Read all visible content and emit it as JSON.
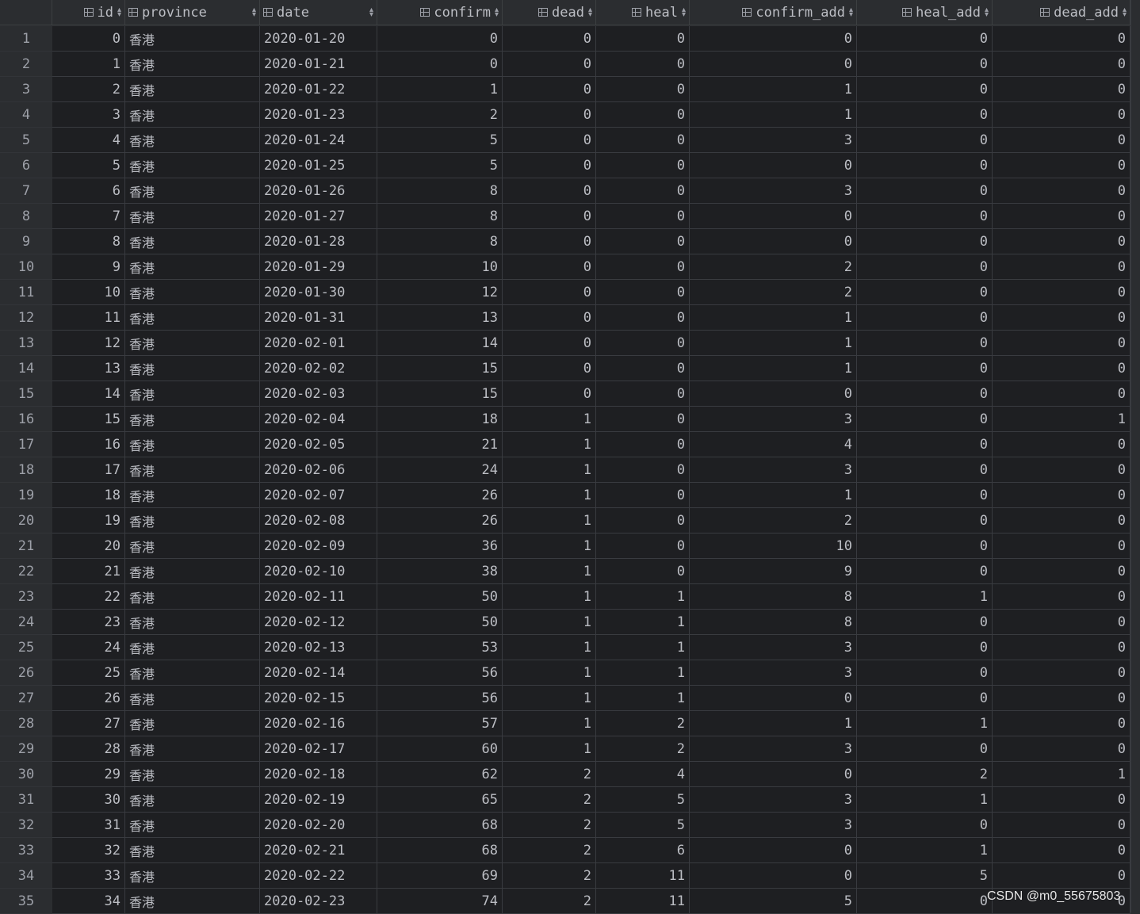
{
  "columns": [
    {
      "key": "id",
      "label": "id",
      "align": "right"
    },
    {
      "key": "province",
      "label": "province",
      "align": "left"
    },
    {
      "key": "date",
      "label": "date",
      "align": "left"
    },
    {
      "key": "confirm",
      "label": "confirm",
      "align": "right"
    },
    {
      "key": "dead",
      "label": "dead",
      "align": "right"
    },
    {
      "key": "heal",
      "label": "heal",
      "align": "right"
    },
    {
      "key": "confirm_add",
      "label": "confirm_add",
      "align": "right"
    },
    {
      "key": "heal_add",
      "label": "heal_add",
      "align": "right"
    },
    {
      "key": "dead_add",
      "label": "dead_add",
      "align": "right"
    }
  ],
  "rows": [
    {
      "n": "1",
      "id": "0",
      "province": "香港",
      "date": "2020-01-20",
      "confirm": "0",
      "dead": "0",
      "heal": "0",
      "confirm_add": "0",
      "heal_add": "0",
      "dead_add": "0"
    },
    {
      "n": "2",
      "id": "1",
      "province": "香港",
      "date": "2020-01-21",
      "confirm": "0",
      "dead": "0",
      "heal": "0",
      "confirm_add": "0",
      "heal_add": "0",
      "dead_add": "0"
    },
    {
      "n": "3",
      "id": "2",
      "province": "香港",
      "date": "2020-01-22",
      "confirm": "1",
      "dead": "0",
      "heal": "0",
      "confirm_add": "1",
      "heal_add": "0",
      "dead_add": "0"
    },
    {
      "n": "4",
      "id": "3",
      "province": "香港",
      "date": "2020-01-23",
      "confirm": "2",
      "dead": "0",
      "heal": "0",
      "confirm_add": "1",
      "heal_add": "0",
      "dead_add": "0"
    },
    {
      "n": "5",
      "id": "4",
      "province": "香港",
      "date": "2020-01-24",
      "confirm": "5",
      "dead": "0",
      "heal": "0",
      "confirm_add": "3",
      "heal_add": "0",
      "dead_add": "0"
    },
    {
      "n": "6",
      "id": "5",
      "province": "香港",
      "date": "2020-01-25",
      "confirm": "5",
      "dead": "0",
      "heal": "0",
      "confirm_add": "0",
      "heal_add": "0",
      "dead_add": "0"
    },
    {
      "n": "7",
      "id": "6",
      "province": "香港",
      "date": "2020-01-26",
      "confirm": "8",
      "dead": "0",
      "heal": "0",
      "confirm_add": "3",
      "heal_add": "0",
      "dead_add": "0"
    },
    {
      "n": "8",
      "id": "7",
      "province": "香港",
      "date": "2020-01-27",
      "confirm": "8",
      "dead": "0",
      "heal": "0",
      "confirm_add": "0",
      "heal_add": "0",
      "dead_add": "0"
    },
    {
      "n": "9",
      "id": "8",
      "province": "香港",
      "date": "2020-01-28",
      "confirm": "8",
      "dead": "0",
      "heal": "0",
      "confirm_add": "0",
      "heal_add": "0",
      "dead_add": "0"
    },
    {
      "n": "10",
      "id": "9",
      "province": "香港",
      "date": "2020-01-29",
      "confirm": "10",
      "dead": "0",
      "heal": "0",
      "confirm_add": "2",
      "heal_add": "0",
      "dead_add": "0"
    },
    {
      "n": "11",
      "id": "10",
      "province": "香港",
      "date": "2020-01-30",
      "confirm": "12",
      "dead": "0",
      "heal": "0",
      "confirm_add": "2",
      "heal_add": "0",
      "dead_add": "0"
    },
    {
      "n": "12",
      "id": "11",
      "province": "香港",
      "date": "2020-01-31",
      "confirm": "13",
      "dead": "0",
      "heal": "0",
      "confirm_add": "1",
      "heal_add": "0",
      "dead_add": "0"
    },
    {
      "n": "13",
      "id": "12",
      "province": "香港",
      "date": "2020-02-01",
      "confirm": "14",
      "dead": "0",
      "heal": "0",
      "confirm_add": "1",
      "heal_add": "0",
      "dead_add": "0"
    },
    {
      "n": "14",
      "id": "13",
      "province": "香港",
      "date": "2020-02-02",
      "confirm": "15",
      "dead": "0",
      "heal": "0",
      "confirm_add": "1",
      "heal_add": "0",
      "dead_add": "0"
    },
    {
      "n": "15",
      "id": "14",
      "province": "香港",
      "date": "2020-02-03",
      "confirm": "15",
      "dead": "0",
      "heal": "0",
      "confirm_add": "0",
      "heal_add": "0",
      "dead_add": "0"
    },
    {
      "n": "16",
      "id": "15",
      "province": "香港",
      "date": "2020-02-04",
      "confirm": "18",
      "dead": "1",
      "heal": "0",
      "confirm_add": "3",
      "heal_add": "0",
      "dead_add": "1"
    },
    {
      "n": "17",
      "id": "16",
      "province": "香港",
      "date": "2020-02-05",
      "confirm": "21",
      "dead": "1",
      "heal": "0",
      "confirm_add": "4",
      "heal_add": "0",
      "dead_add": "0"
    },
    {
      "n": "18",
      "id": "17",
      "province": "香港",
      "date": "2020-02-06",
      "confirm": "24",
      "dead": "1",
      "heal": "0",
      "confirm_add": "3",
      "heal_add": "0",
      "dead_add": "0"
    },
    {
      "n": "19",
      "id": "18",
      "province": "香港",
      "date": "2020-02-07",
      "confirm": "26",
      "dead": "1",
      "heal": "0",
      "confirm_add": "1",
      "heal_add": "0",
      "dead_add": "0"
    },
    {
      "n": "20",
      "id": "19",
      "province": "香港",
      "date": "2020-02-08",
      "confirm": "26",
      "dead": "1",
      "heal": "0",
      "confirm_add": "2",
      "heal_add": "0",
      "dead_add": "0"
    },
    {
      "n": "21",
      "id": "20",
      "province": "香港",
      "date": "2020-02-09",
      "confirm": "36",
      "dead": "1",
      "heal": "0",
      "confirm_add": "10",
      "heal_add": "0",
      "dead_add": "0"
    },
    {
      "n": "22",
      "id": "21",
      "province": "香港",
      "date": "2020-02-10",
      "confirm": "38",
      "dead": "1",
      "heal": "0",
      "confirm_add": "9",
      "heal_add": "0",
      "dead_add": "0"
    },
    {
      "n": "23",
      "id": "22",
      "province": "香港",
      "date": "2020-02-11",
      "confirm": "50",
      "dead": "1",
      "heal": "1",
      "confirm_add": "8",
      "heal_add": "1",
      "dead_add": "0"
    },
    {
      "n": "24",
      "id": "23",
      "province": "香港",
      "date": "2020-02-12",
      "confirm": "50",
      "dead": "1",
      "heal": "1",
      "confirm_add": "8",
      "heal_add": "0",
      "dead_add": "0"
    },
    {
      "n": "25",
      "id": "24",
      "province": "香港",
      "date": "2020-02-13",
      "confirm": "53",
      "dead": "1",
      "heal": "1",
      "confirm_add": "3",
      "heal_add": "0",
      "dead_add": "0"
    },
    {
      "n": "26",
      "id": "25",
      "province": "香港",
      "date": "2020-02-14",
      "confirm": "56",
      "dead": "1",
      "heal": "1",
      "confirm_add": "3",
      "heal_add": "0",
      "dead_add": "0"
    },
    {
      "n": "27",
      "id": "26",
      "province": "香港",
      "date": "2020-02-15",
      "confirm": "56",
      "dead": "1",
      "heal": "1",
      "confirm_add": "0",
      "heal_add": "0",
      "dead_add": "0"
    },
    {
      "n": "28",
      "id": "27",
      "province": "香港",
      "date": "2020-02-16",
      "confirm": "57",
      "dead": "1",
      "heal": "2",
      "confirm_add": "1",
      "heal_add": "1",
      "dead_add": "0"
    },
    {
      "n": "29",
      "id": "28",
      "province": "香港",
      "date": "2020-02-17",
      "confirm": "60",
      "dead": "1",
      "heal": "2",
      "confirm_add": "3",
      "heal_add": "0",
      "dead_add": "0"
    },
    {
      "n": "30",
      "id": "29",
      "province": "香港",
      "date": "2020-02-18",
      "confirm": "62",
      "dead": "2",
      "heal": "4",
      "confirm_add": "0",
      "heal_add": "2",
      "dead_add": "1"
    },
    {
      "n": "31",
      "id": "30",
      "province": "香港",
      "date": "2020-02-19",
      "confirm": "65",
      "dead": "2",
      "heal": "5",
      "confirm_add": "3",
      "heal_add": "1",
      "dead_add": "0"
    },
    {
      "n": "32",
      "id": "31",
      "province": "香港",
      "date": "2020-02-20",
      "confirm": "68",
      "dead": "2",
      "heal": "5",
      "confirm_add": "3",
      "heal_add": "0",
      "dead_add": "0"
    },
    {
      "n": "33",
      "id": "32",
      "province": "香港",
      "date": "2020-02-21",
      "confirm": "68",
      "dead": "2",
      "heal": "6",
      "confirm_add": "0",
      "heal_add": "1",
      "dead_add": "0"
    },
    {
      "n": "34",
      "id": "33",
      "province": "香港",
      "date": "2020-02-22",
      "confirm": "69",
      "dead": "2",
      "heal": "11",
      "confirm_add": "0",
      "heal_add": "5",
      "dead_add": "0"
    },
    {
      "n": "35",
      "id": "34",
      "province": "香港",
      "date": "2020-02-23",
      "confirm": "74",
      "dead": "2",
      "heal": "11",
      "confirm_add": "5",
      "heal_add": "0",
      "dead_add": "0"
    }
  ],
  "watermark": "CSDN @m0_55675803",
  "icons": {
    "column": "table-column-icon",
    "sort": "sort-arrows-icon"
  },
  "colors": {
    "background": "#2b2d30",
    "cell": "#1e1f22",
    "text": "#bcbec4"
  }
}
